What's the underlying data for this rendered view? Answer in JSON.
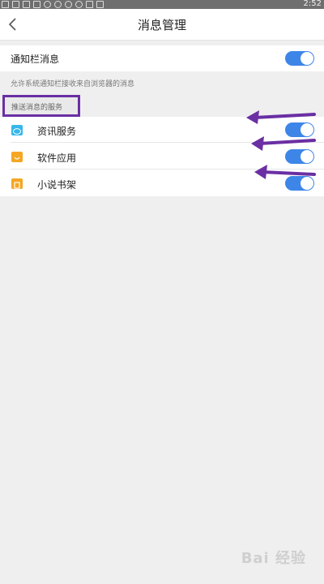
{
  "status_bar": {
    "time": "2:52",
    "icons": [
      "notification-icon",
      "notification-icon",
      "notification-icon",
      "notification-icon",
      "search-icon",
      "weather-icon",
      "search-icon",
      "app-icon",
      "image-icon",
      "text-icon"
    ]
  },
  "header": {
    "title": "消息管理",
    "back_icon": "chevron-left-icon"
  },
  "notify_setting": {
    "label": "通知栏消息",
    "enabled": true
  },
  "notify_description": "允许系统通知栏接收来自浏览器的消息",
  "push_section": {
    "label": "推送消息的服务"
  },
  "services": [
    {
      "label": "资讯服务",
      "icon": "chat-bubble-icon",
      "color": "#36b7ea",
      "enabled": true
    },
    {
      "label": "软件应用",
      "icon": "bag-icon",
      "color": "#f6a623",
      "enabled": true
    },
    {
      "label": "小说书架",
      "icon": "book-icon",
      "color": "#f5a623",
      "enabled": true
    }
  ],
  "colors": {
    "toggle_on": "#3d86e8",
    "annotation": "#6a2fa3"
  },
  "watermark": "Bai 经验"
}
